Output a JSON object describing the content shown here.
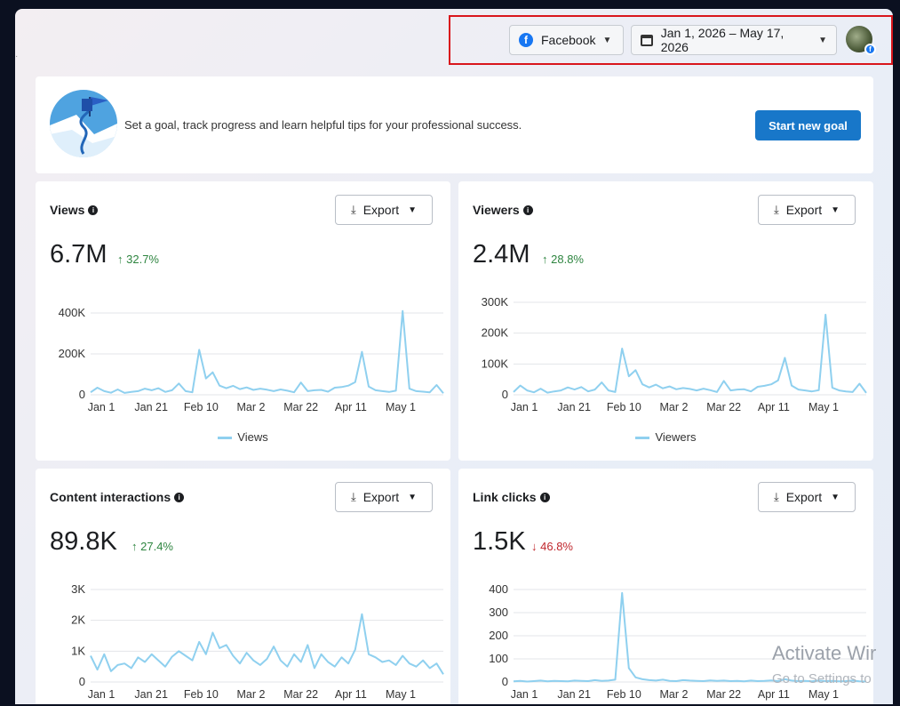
{
  "topbar": {
    "platform": "Facebook",
    "date_range": "Jan 1, 2026 – May 17, 2026"
  },
  "goal": {
    "text": "Set a goal, track progress and learn helpful tips for your professional success.",
    "button": "Start new goal"
  },
  "export_label": "Export",
  "x_ticks": [
    "Jan 1",
    "Jan 21",
    "Feb 10",
    "Mar 2",
    "Mar 22",
    "Apr 11",
    "May 1"
  ],
  "cards": [
    {
      "title": "Views",
      "value": "6.7M",
      "change": "32.7%",
      "direction": "up",
      "legend": "Views"
    },
    {
      "title": "Viewers",
      "value": "2.4M",
      "change": "28.8%",
      "direction": "up",
      "legend": "Viewers"
    },
    {
      "title": "Content interactions",
      "value": "89.8K",
      "change": "27.4%",
      "direction": "up"
    },
    {
      "title": "Link clicks",
      "value": "1.5K",
      "change": "46.8%",
      "direction": "down"
    }
  ],
  "colors": {
    "line": "#8fd0ef",
    "up": "#2e8540",
    "down": "#c0272d",
    "accent": "#1877c9"
  },
  "watermark": {
    "line1": "Activate Wir",
    "line2": "Go to Settings to"
  },
  "chart_data": [
    {
      "type": "line",
      "title": "Views",
      "ylim": [
        0,
        400000
      ],
      "y_ticks": [
        "0",
        "200K",
        "400K"
      ],
      "series": [
        {
          "name": "Views",
          "values": [
            12000,
            35000,
            18000,
            10000,
            26000,
            9000,
            14000,
            18000,
            30000,
            22000,
            32000,
            14000,
            22000,
            55000,
            18000,
            12000,
            220000,
            80000,
            110000,
            45000,
            32000,
            44000,
            28000,
            36000,
            24000,
            30000,
            25000,
            18000,
            26000,
            20000,
            12000,
            60000,
            18000,
            22000,
            24000,
            15000,
            35000,
            38000,
            45000,
            62000,
            210000,
            40000,
            22000,
            18000,
            14000,
            20000,
            410000,
            30000,
            18000,
            15000,
            12000,
            48000,
            8000
          ]
        }
      ]
    },
    {
      "type": "line",
      "title": "Viewers",
      "ylim": [
        0,
        300000
      ],
      "y_ticks": [
        "0",
        "100K",
        "200K",
        "300K"
      ],
      "series": [
        {
          "name": "Viewers",
          "values": [
            9000,
            30000,
            14000,
            8000,
            20000,
            7000,
            11000,
            14000,
            24000,
            17000,
            25000,
            11000,
            17000,
            40000,
            14000,
            9000,
            150000,
            60000,
            80000,
            34000,
            24000,
            33000,
            21000,
            27000,
            18000,
            22000,
            19000,
            14000,
            20000,
            15000,
            9000,
            45000,
            14000,
            17000,
            18000,
            11000,
            26000,
            29000,
            34000,
            47000,
            120000,
            30000,
            17000,
            14000,
            11000,
            15000,
            260000,
            23000,
            14000,
            11000,
            9000,
            36000,
            6000
          ]
        }
      ]
    },
    {
      "type": "line",
      "title": "Content interactions",
      "ylim": [
        0,
        3000
      ],
      "y_ticks": [
        "0",
        "1K",
        "2K",
        "3K"
      ],
      "series": [
        {
          "name": "Content interactions",
          "values": [
            850,
            400,
            900,
            350,
            550,
            600,
            450,
            800,
            650,
            900,
            700,
            500,
            820,
            1000,
            850,
            700,
            1300,
            900,
            1600,
            1100,
            1200,
            850,
            600,
            950,
            700,
            550,
            750,
            1150,
            700,
            500,
            900,
            650,
            1200,
            450,
            900,
            650,
            500,
            800,
            600,
            1050,
            2200,
            900,
            800,
            650,
            700,
            550,
            850,
            600,
            500,
            700,
            450,
            600,
            250
          ]
        }
      ]
    },
    {
      "type": "line",
      "title": "Link clicks",
      "ylim": [
        0,
        400
      ],
      "y_ticks": [
        "0",
        "100",
        "200",
        "300",
        "400"
      ],
      "series": [
        {
          "name": "Link clicks",
          "values": [
            3,
            5,
            2,
            4,
            6,
            3,
            5,
            4,
            3,
            6,
            5,
            4,
            8,
            5,
            6,
            10,
            385,
            60,
            20,
            12,
            8,
            6,
            10,
            5,
            4,
            8,
            6,
            5,
            4,
            7,
            5,
            6,
            4,
            5,
            3,
            6,
            4,
            5,
            7,
            4,
            12,
            6,
            4,
            5,
            3,
            6,
            4,
            5,
            3,
            4,
            6,
            3,
            2
          ]
        }
      ]
    }
  ]
}
